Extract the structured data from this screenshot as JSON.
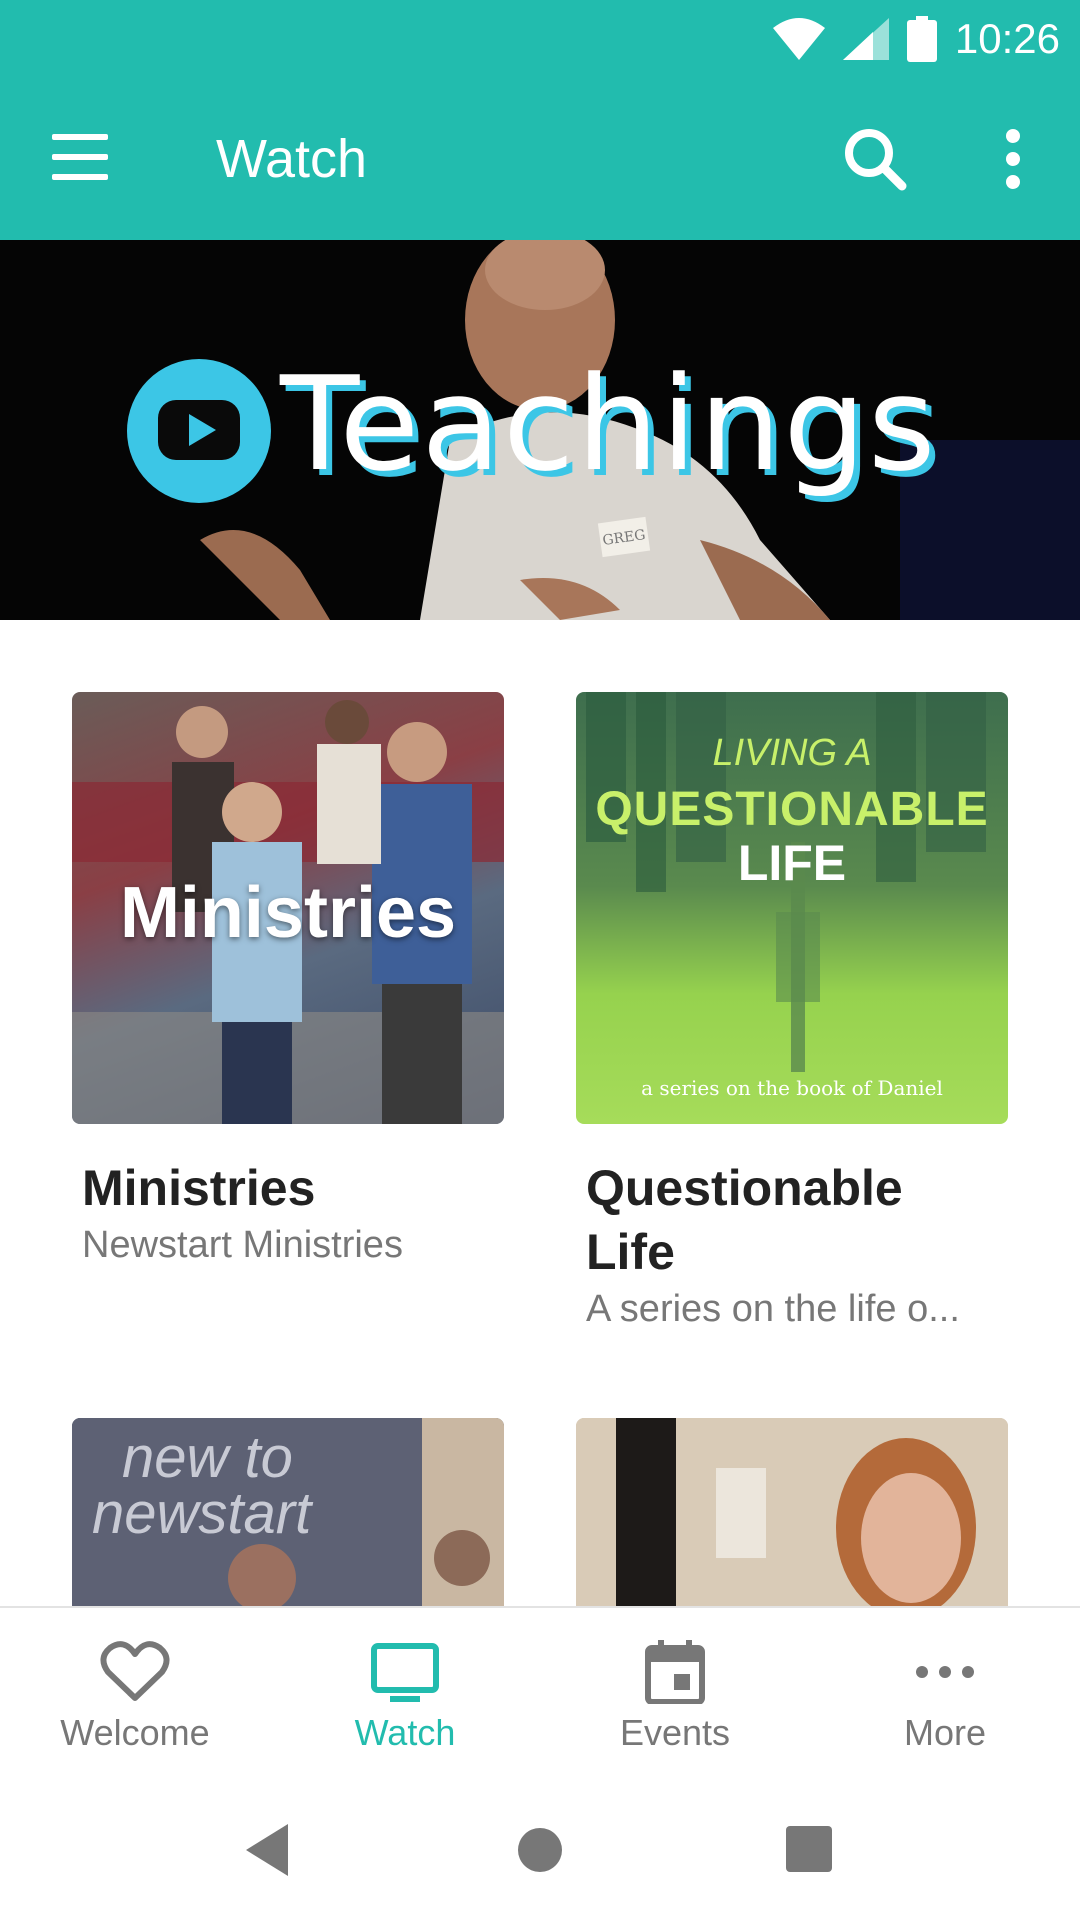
{
  "status_bar": {
    "time": "10:26"
  },
  "app_bar": {
    "title": "Watch"
  },
  "hero": {
    "title": "Teachings",
    "name_tag": "GREG"
  },
  "cards": [
    {
      "title": "Ministries",
      "subtitle": "Newstart Ministries",
      "image_text": "Ministries"
    },
    {
      "title_line1": "Questionable",
      "title_line2": "Life",
      "subtitle": "A series on the life o...",
      "image_text": {
        "line1": "LIVING A",
        "line2": "QUESTIONABLE",
        "line3": "LIFE",
        "tagline": "a series on the book of Daniel"
      }
    }
  ],
  "partial_cards": [
    {
      "image_text_line1": "new to",
      "image_text_line2": "newstart"
    }
  ],
  "tabs": [
    {
      "label": "Welcome",
      "icon": "heart-icon",
      "active": false
    },
    {
      "label": "Watch",
      "icon": "tv-icon",
      "active": true
    },
    {
      "label": "Events",
      "icon": "calendar-icon",
      "active": false
    },
    {
      "label": "More",
      "icon": "more-horizontal-icon",
      "active": false
    }
  ],
  "colors": {
    "primary": "#22bcae",
    "accent": "#3cc6e6",
    "inactive": "#777777",
    "text": "#222222"
  }
}
